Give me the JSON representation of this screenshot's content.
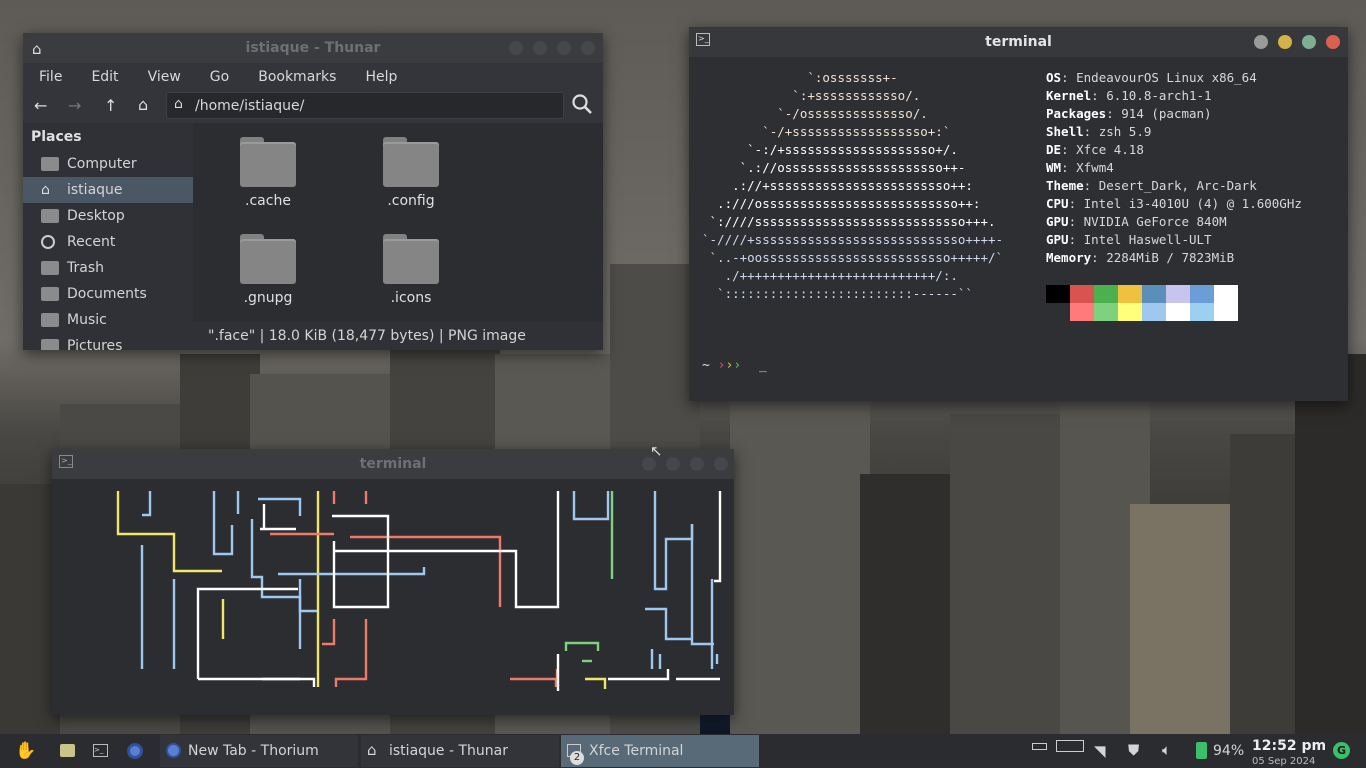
{
  "thunar": {
    "title": "istiaque - Thunar",
    "menu": [
      "File",
      "Edit",
      "View",
      "Go",
      "Bookmarks",
      "Help"
    ],
    "path": "/home/istiaque/",
    "places_header": "Places",
    "places": [
      {
        "label": "Computer",
        "icon": "computer-icon"
      },
      {
        "label": "istiaque",
        "icon": "home-icon",
        "selected": true
      },
      {
        "label": "Desktop",
        "icon": "desktop-icon"
      },
      {
        "label": "Recent",
        "icon": "recent-icon"
      },
      {
        "label": "Trash",
        "icon": "trash-icon"
      },
      {
        "label": "Documents",
        "icon": "documents-icon"
      },
      {
        "label": "Music",
        "icon": "music-icon"
      },
      {
        "label": "Pictures",
        "icon": "pictures-icon"
      }
    ],
    "files": [
      ".cache",
      ".config",
      ".gnupg",
      ".icons"
    ],
    "status": "\".face\"  |  18.0 KiB (18,477 bytes)  |  PNG image"
  },
  "term1": {
    "title": "terminal",
    "logo": [
      "              `:osssssss+-",
      "            `:+ssssssssssso/.",
      "          `-/ossssssssssssso/.",
      "        `-/+ssssssssssssssssso+:`",
      "      `-:/+ssssssssssssssssssso+/.",
      "     `.://osssssssssssssssssssso++-",
      "    .://+ssssssssssssssssssssssso++:",
      "  .:///ossssssssssssssssssssssssso++:",
      " `:////ssssssssssssssssssssssssssso+++.",
      "`-////+ssssssssssssssssssssssssssso++++-",
      " `..-+oosssssssssssssssssssssssso+++++/`",
      "   ./++++++++++++++++++++++++++/:.",
      "  `:::::::::::::::::::::::::------``"
    ],
    "info": [
      {
        "k": "OS",
        "v": "EndeavourOS Linux x86_64"
      },
      {
        "k": "Kernel",
        "v": "6.10.8-arch1-1"
      },
      {
        "k": "Packages",
        "v": "914 (pacman)"
      },
      {
        "k": "Shell",
        "v": "zsh 5.9"
      },
      {
        "k": "DE",
        "v": "Xfce 4.18"
      },
      {
        "k": "WM",
        "v": "Xfwm4"
      },
      {
        "k": "Theme",
        "v": "Desert_Dark, Arc-Dark"
      },
      {
        "k": "CPU",
        "v": "Intel i3-4010U (4) @ 1.600GHz"
      },
      {
        "k": "GPU",
        "v": "NVIDIA GeForce 840M"
      },
      {
        "k": "GPU",
        "v": "Intel Haswell-ULT"
      },
      {
        "k": "Memory",
        "v": "2284MiB / 7823MiB"
      }
    ],
    "palette_top": [
      "#000000",
      "#d9534f",
      "#4caf50",
      "#f0c040",
      "#5b8fb9",
      "#c8c4f0",
      "#6b9ed6",
      "#ffffff"
    ],
    "palette_bot": [
      "#2d2f33",
      "#ff7b7b",
      "#7fd17f",
      "#ffff7a",
      "#9fc8ee",
      "#ffffff",
      "#9dd0f0",
      "#ffffff"
    ],
    "prompt": "~",
    "cursor": "_"
  },
  "term2": {
    "title": "terminal"
  },
  "taskbar": {
    "tasks": [
      {
        "label": "New Tab - Thorium"
      },
      {
        "label": "istiaque - Thunar"
      },
      {
        "label": "Xfce Terminal",
        "badge": "2",
        "active": true
      }
    ],
    "battery": "94%",
    "time": "12:52 pm",
    "date": "05 Sep 2024"
  }
}
